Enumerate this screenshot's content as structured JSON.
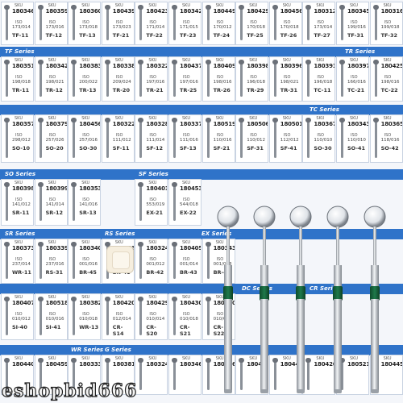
{
  "bands": [
    {
      "label": "TF Series",
      "pos": "row2"
    },
    {
      "label": "TR Series",
      "pos": "row2right"
    },
    {
      "label": "TC Series",
      "pos": "row3right"
    },
    {
      "label": "SO Series",
      "pos": "row4"
    },
    {
      "label": "SF Series",
      "pos": "row4b"
    },
    {
      "label": "SR Series",
      "pos": "row5"
    },
    {
      "label": "RS Series",
      "pos": "row5b"
    },
    {
      "label": "EX Series",
      "pos": "row5c"
    },
    {
      "label": "DC Series",
      "pos": "row6"
    },
    {
      "label": "CR Series",
      "pos": "row6b"
    },
    {
      "label": "WR Series",
      "pos": "row7"
    },
    {
      "label": "G Series",
      "pos": "row7b"
    }
  ],
  "rows": [
    {
      "codes": [
        "180346",
        "180359",
        "180360",
        "180439",
        "180423",
        "180342",
        "180449",
        "180429",
        "180456",
        "180312",
        "180345",
        "180316"
      ],
      "isos": [
        "173/014",
        "173/016",
        "173/018",
        "173/023",
        "171/014",
        "171/015",
        "170/012",
        "170/018",
        "170/018",
        "173/014",
        "199/016",
        "199/018"
      ],
      "models": [
        "TF-11",
        "TF-12",
        "TF-13",
        "TF-21",
        "TF-22",
        "TF-23",
        "TF-24",
        "TF-25",
        "TF-26",
        "TF-27",
        "TF-31",
        "TF-32"
      ]
    },
    {
      "codes": [
        "180351",
        "180342",
        "180383",
        "180338",
        "180322",
        "180437",
        "180409",
        "180398",
        "180396",
        "180391",
        "180397",
        "180425"
      ],
      "isos": [
        "198/018",
        "198/021",
        "200/022",
        "209/024",
        "197/016",
        "197/016",
        "198/016",
        "196/018",
        "198/021",
        "196/018",
        "166/016",
        "198/016"
      ],
      "models": [
        "TR-11",
        "TR-12",
        "TR-13",
        "TR-20",
        "TR-21",
        "TR-25",
        "TR-26",
        "TR-29",
        "TR-31",
        "TC-11",
        "TC-21",
        "TC-22"
      ]
    },
    {
      "codes": [
        "180357",
        "180379",
        "180456",
        "180322",
        "180328",
        "180337",
        "180519",
        "180506",
        "180501",
        "180367",
        "180343",
        "180365"
      ],
      "isos": [
        "298/012",
        "257/026",
        "257/016",
        "111/012",
        "111/014",
        "111/016",
        "110/016",
        "110/012",
        "112/012",
        "110/010",
        "110/010",
        "118/016"
      ],
      "models": [
        "SO-10",
        "SO-20",
        "SO-30",
        "SF-11",
        "SF-12",
        "SF-13",
        "SF-21",
        "SF-31",
        "SF-41",
        "SO-30",
        "SO-41",
        "SO-42"
      ]
    },
    {
      "codes": [
        "180398",
        "180399",
        "180353",
        "",
        "180401",
        "180453",
        "",
        "",
        "",
        "",
        "",
        ""
      ],
      "isos": [
        "141/012",
        "141/014",
        "141/016",
        "",
        "553/019",
        "544/018",
        "",
        "",
        "",
        "",
        "",
        ""
      ],
      "models": [
        "SR-11",
        "SR-12",
        "SR-13",
        "",
        "EX-21",
        "EX-22",
        "",
        "",
        "",
        "",
        "",
        ""
      ]
    },
    {
      "codes": [
        "180373",
        "180339",
        "180340",
        "180323",
        "180324",
        "180405",
        "180343",
        "",
        "",
        "",
        "",
        ""
      ],
      "isos": [
        "237/014",
        "237/016",
        "001/016",
        "001/018",
        "001/012",
        "001/014",
        "001/018",
        "",
        "",
        "",
        "",
        ""
      ],
      "models": [
        "WR-11",
        "RS-31",
        "BR-45",
        "BR-41",
        "BR-42",
        "BR-43",
        "BR-44",
        "",
        "",
        "",
        "",
        ""
      ]
    },
    {
      "codes": [
        "180407",
        "180518",
        "180382",
        "180420",
        "180429",
        "180430",
        "180410",
        "",
        "",
        "",
        "",
        ""
      ],
      "isos": [
        "010/012",
        "010/016",
        "010/018",
        "012/014",
        "010/014",
        "010/018",
        "010/020",
        "",
        "",
        "",
        "",
        ""
      ],
      "models": [
        "SI-40",
        "SI-41",
        "WR-13",
        "CR-S14",
        "CR-S20",
        "CR-S21",
        "CR-S22",
        "",
        "",
        "",
        "",
        ""
      ]
    },
    {
      "codes": [
        "180440",
        "180459",
        "180333",
        "180381",
        "180324",
        "180346",
        "180446",
        "180444",
        "180440",
        "180426",
        "180521",
        "180445"
      ],
      "isos": [
        "",
        "",
        "",
        "",
        "",
        "",
        "",
        "",
        "",
        "",
        "",
        ""
      ],
      "models": [
        "",
        "",
        "",
        "",
        "",
        "",
        "",
        "",
        "",
        "",
        "",
        ""
      ]
    }
  ],
  "labels": {
    "sku": "SKU",
    "iso": "ISO"
  },
  "watermark": "eshopbid666",
  "colors": {
    "band": "#2f73c9",
    "collar": "#1f7a4b",
    "shank": "#c9ced4",
    "head": "#dfe3e8"
  }
}
